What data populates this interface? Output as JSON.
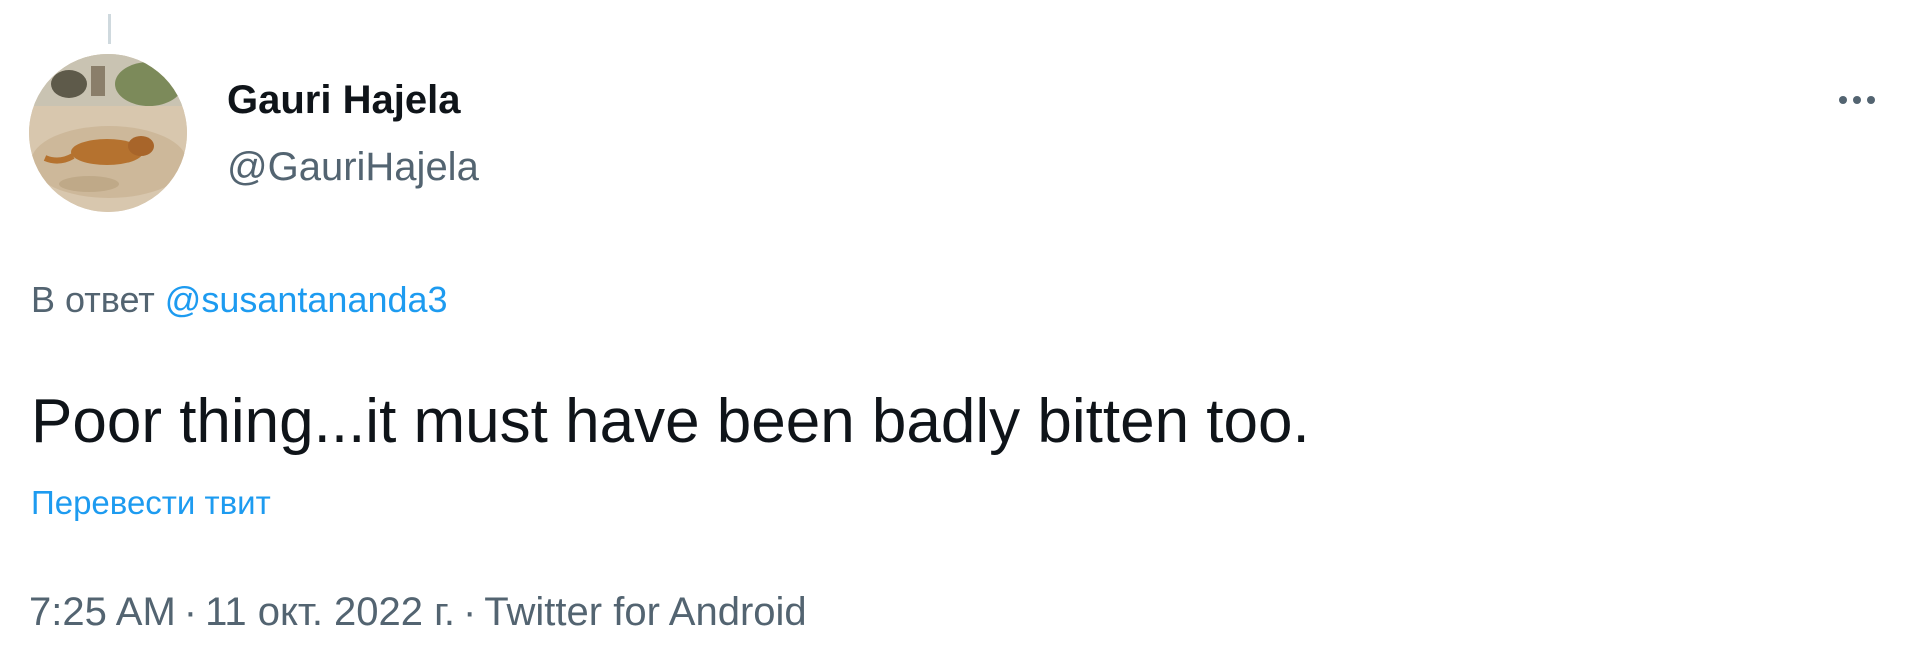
{
  "author": {
    "name": "Gauri Hajela",
    "handle": "@GauriHajela",
    "avatar_icon": "avatar-image-dog"
  },
  "more_button": {
    "icon": "more-icon"
  },
  "reply": {
    "prefix": "В ответ",
    "mention": "@susantananda3"
  },
  "tweet": {
    "text": "Poor thing...it must have been badly bitten too.",
    "translate_label": "Перевести твит"
  },
  "meta": {
    "time": "7:25 AM",
    "separator": "·",
    "date": "11 окт. 2022 г.",
    "source": "Twitter for Android"
  },
  "colors": {
    "text_primary": "#0f1419",
    "text_secondary": "#536471",
    "accent_blue": "#1d9bf0"
  }
}
